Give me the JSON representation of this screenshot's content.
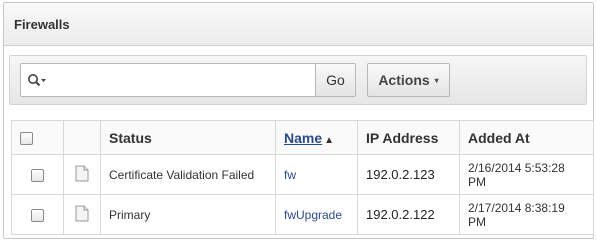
{
  "region": {
    "title": "Firewalls"
  },
  "toolbar": {
    "search_placeholder": "",
    "go_label": "Go",
    "actions_label": "Actions",
    "caret": "▾"
  },
  "table": {
    "headers": {
      "status": "Status",
      "name": "Name",
      "name_sort": "▲",
      "ip": "IP Address",
      "added": "Added At"
    },
    "rows": [
      {
        "status": "Certificate Validation Failed",
        "name": "fw",
        "ip": "192.0.2.123",
        "added": "2/16/2014 5:53:28 PM"
      },
      {
        "status": "Primary",
        "name": "fwUpgrade",
        "ip": "192.0.2.122",
        "added": "2/17/2014 8:38:19 PM"
      }
    ]
  },
  "icons": {
    "search": "search-icon",
    "file": "file-icon"
  },
  "colors": {
    "link": "#2b4a8a",
    "border": "#d8d8d8"
  }
}
